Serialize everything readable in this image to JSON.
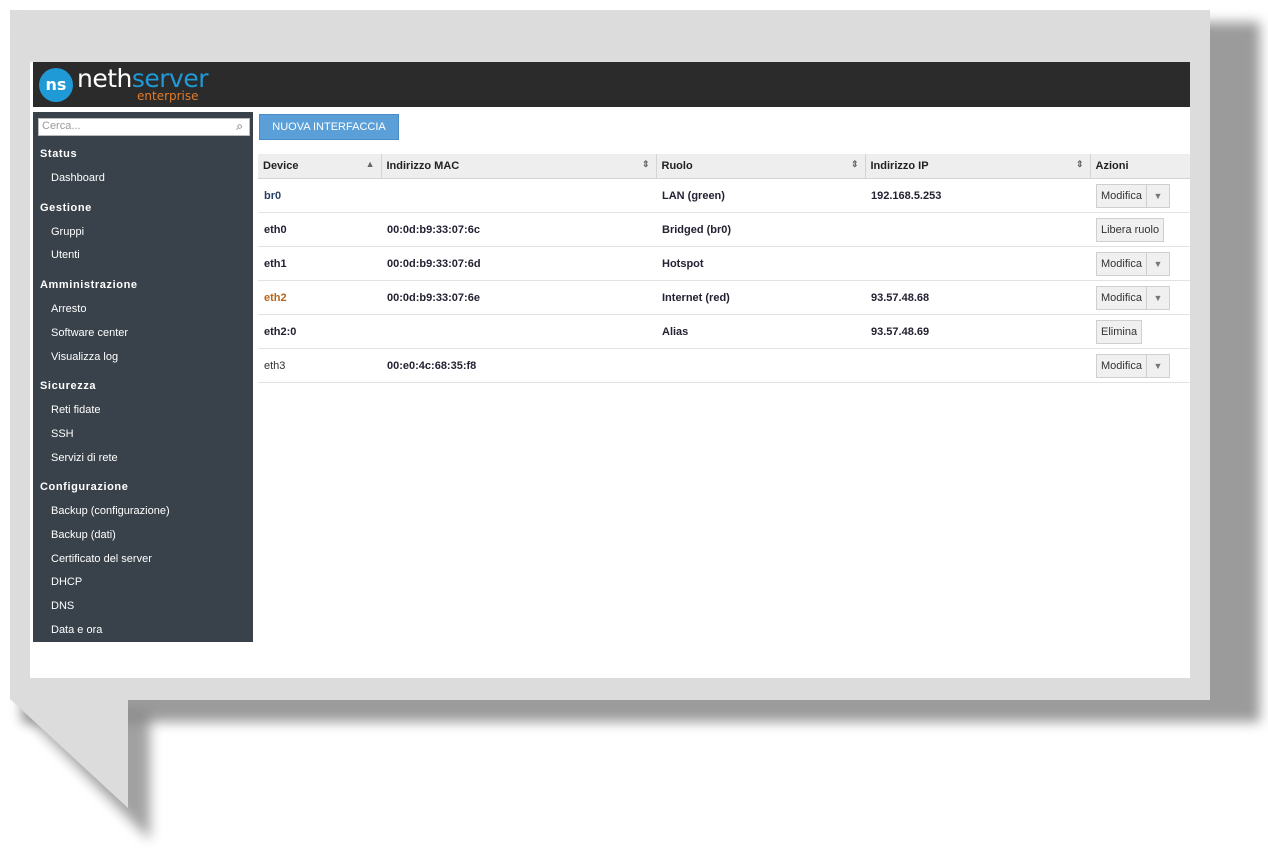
{
  "brand": {
    "logo_mark": "ns",
    "name_part1": "neth",
    "name_part2": "server",
    "sub": "enterprise"
  },
  "search": {
    "placeholder": "Cerca..."
  },
  "sidebar": {
    "sections": [
      {
        "title": "Status",
        "items": [
          "Dashboard"
        ]
      },
      {
        "title": "Gestione",
        "items": [
          "Gruppi",
          "Utenti"
        ]
      },
      {
        "title": "Amministrazione",
        "items": [
          "Arresto",
          "Software center",
          "Visualizza log"
        ]
      },
      {
        "title": "Sicurezza",
        "items": [
          "Reti fidate",
          "SSH",
          "Servizi di rete"
        ]
      },
      {
        "title": "Configurazione",
        "items": [
          "Backup (configurazione)",
          "Backup (dati)",
          "Certificato del server",
          "DHCP",
          "DNS",
          "Data e ora"
        ]
      }
    ]
  },
  "toolbar": {
    "new_label": "NUOVA INTERFACCIA"
  },
  "table": {
    "columns": [
      "Device",
      "Indirizzo MAC",
      "Ruolo",
      "Indirizzo IP",
      "Azioni"
    ],
    "rows": [
      {
        "device": "br0",
        "mac": "",
        "role": "LAN (green)",
        "ip": "192.168.5.253",
        "action": "Modifica",
        "dropdown": true
      },
      {
        "device": "eth0",
        "mac": "00:0d:b9:33:07:6c",
        "role": "Bridged (br0)",
        "ip": "",
        "action": "Libera ruolo",
        "dropdown": false
      },
      {
        "device": "eth1",
        "mac": "00:0d:b9:33:07:6d",
        "role": "Hotspot",
        "ip": "",
        "action": "Modifica",
        "dropdown": true
      },
      {
        "device": "eth2",
        "mac": "00:0d:b9:33:07:6e",
        "role": "Internet (red)",
        "ip": "93.57.48.68",
        "action": "Modifica",
        "dropdown": true
      },
      {
        "device": "eth2:0",
        "mac": "",
        "role": "Alias",
        "ip": "93.57.48.69",
        "action": "Elimina",
        "dropdown": false
      },
      {
        "device": "eth3",
        "mac": "00:e0:4c:68:35:f8",
        "role": "",
        "ip": "",
        "action": "Modifica",
        "dropdown": true
      }
    ]
  }
}
